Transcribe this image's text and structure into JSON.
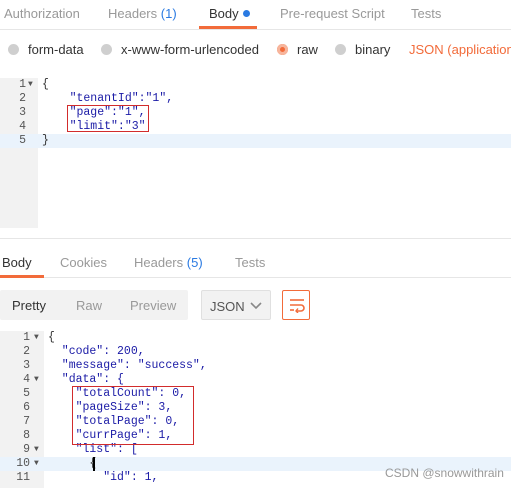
{
  "request_tabs": [
    {
      "label": "Authorization"
    },
    {
      "label": "Headers",
      "count": "(1)"
    },
    {
      "label": "Body"
    },
    {
      "label": "Pre-request Script"
    },
    {
      "label": "Tests"
    }
  ],
  "body_modes": {
    "form_data": "form-data",
    "urlencoded": "x-www-form-urlencoded",
    "raw": "raw",
    "binary": "binary",
    "selected": "raw",
    "content_type": "JSON (application/j"
  },
  "request_editor": {
    "line_numbers": [
      "1",
      "2",
      "3",
      "4",
      "5"
    ],
    "lines": [
      "{",
      "    \"tenantId\":\"1\",",
      "    \"page\":\"1\",",
      "    \"limit\":\"3\"",
      "}"
    ]
  },
  "response_tabs": [
    {
      "label": "Body"
    },
    {
      "label": "Cookies"
    },
    {
      "label": "Headers",
      "count": "(5)"
    },
    {
      "label": "Tests"
    }
  ],
  "response_toolbar": {
    "pretty": "Pretty",
    "raw": "Raw",
    "preview": "Preview",
    "format": "JSON"
  },
  "response_editor": {
    "line_numbers": [
      "1",
      "2",
      "3",
      "4",
      "5",
      "6",
      "7",
      "8",
      "9",
      "10",
      "11"
    ],
    "lines": [
      "{",
      "  \"code\": 200,",
      "  \"message\": \"success\",",
      "  \"data\": {",
      "    \"totalCount\": 0,",
      "    \"pageSize\": 3,",
      "    \"totalPage\": 0,",
      "    \"currPage\": 1,",
      "    \"list\": [",
      "      {",
      "        \"id\": 1,"
    ]
  },
  "watermark": "CSDN @snowwithrain",
  "colors": {
    "accent": "#f26b3a",
    "link": "#2a7ae2",
    "highlight_box": "#d22c2c"
  }
}
